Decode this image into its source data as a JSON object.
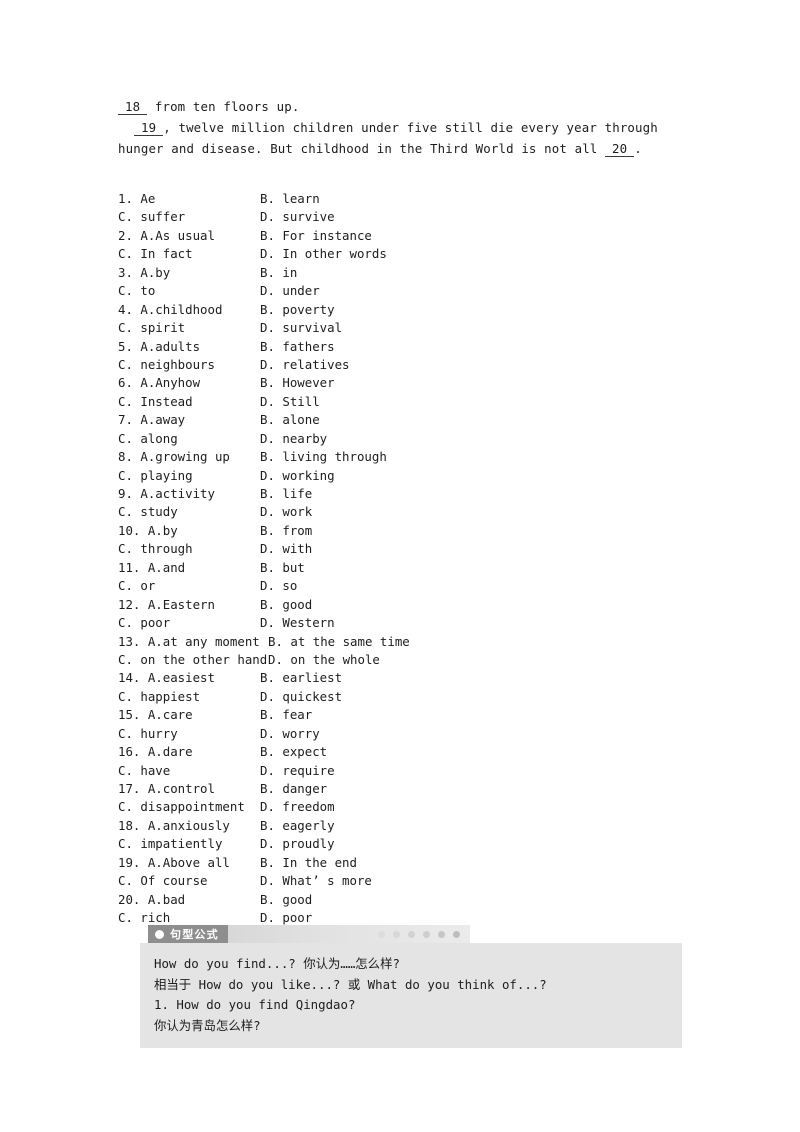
{
  "passage": {
    "line1_blank": "18",
    "line1_after": " from ten floors up.",
    "line2_blank": "19",
    "line2_after": ", twelve million children under five still die every year through",
    "line3_before": "hunger and disease. But childhood in the Third World is not all ",
    "line3_blank": "20",
    "line3_after": "."
  },
  "options": [
    {
      "a": "1. Ae",
      "b": "B. learn",
      "c": "C. suffer",
      "d": "D. survive"
    },
    {
      "a": "2. A.As usual",
      "b": "B. For instance",
      "c": "C. In fact",
      "d": "D. In other words"
    },
    {
      "a": "3. A.by",
      "b": "B. in",
      "c": "C. to",
      "d": "D. under"
    },
    {
      "a": "4. A.childhood",
      "b": "B. poverty",
      "c": "C. spirit",
      "d": "D. survival"
    },
    {
      "a": "5. A.adults",
      "b": "B. fathers",
      "c": "C. neighbours",
      "d": "D. relatives"
    },
    {
      "a": "6. A.Anyhow",
      "b": "B. However",
      "c": "C. Instead",
      "d": "D. Still"
    },
    {
      "a": "7. A.away",
      "b": "B. alone",
      "c": "C. along",
      "d": "D. nearby"
    },
    {
      "a": "8. A.growing up",
      "b": "B. living through",
      "c": "C. playing",
      "d": "D. working"
    },
    {
      "a": "9. A.activity",
      "b": "B. life",
      "c": "C. study",
      "d": "D. work"
    },
    {
      "a": "10. A.by",
      "b": "B. from",
      "c": "C. through",
      "d": "D. with"
    },
    {
      "a": "11. A.and",
      "b": "B. but",
      "c": "C. or",
      "d": "D. so"
    },
    {
      "a": "12. A.Eastern",
      "b": "B. good",
      "c": "C. poor",
      "d": "D. Western"
    },
    {
      "a": "13. A.at any moment",
      "b": "B. at the same time",
      "c": "C. on the other hand",
      "d": "D. on the whole",
      "wide": true
    },
    {
      "a": "14. A.easiest",
      "b": "B. earliest",
      "c": "C. happiest",
      "d": "D. quickest"
    },
    {
      "a": "15. A.care",
      "b": "B. fear",
      "c": "C. hurry",
      "d": "D. worry"
    },
    {
      "a": "16. A.dare",
      "b": "B. expect",
      "c": "C. have",
      "d": "D. require"
    },
    {
      "a": "17. A.control",
      "b": "B. danger",
      "c": "C. disappointment",
      "d": "D. freedom"
    },
    {
      "a": "18. A.anxiously",
      "b": "B. eagerly",
      "c": "C. impatiently",
      "d": "D. proudly"
    },
    {
      "a": "19. A.Above all",
      "b": "B. In the end",
      "c": "C. Of course",
      "d": "D. What’ s more"
    },
    {
      "a": "20. A.bad",
      "b": "B. good",
      "c": "C. rich",
      "d": "D. poor"
    }
  ],
  "note": {
    "tab_label": "句型公式",
    "dots_count": 6,
    "lines": [
      "How do you find...? 你认为……怎么样?",
      "相当于 How do you like...? 或 What do you think of...?",
      "1. How do you find Qingdao?",
      "你认为青岛怎么样?"
    ]
  },
  "colors": {
    "tab_background": "#8e8e8e",
    "header_bar": "#dcdcdc",
    "card_background": "#e4e4e4",
    "text": "#1d1d1d"
  }
}
